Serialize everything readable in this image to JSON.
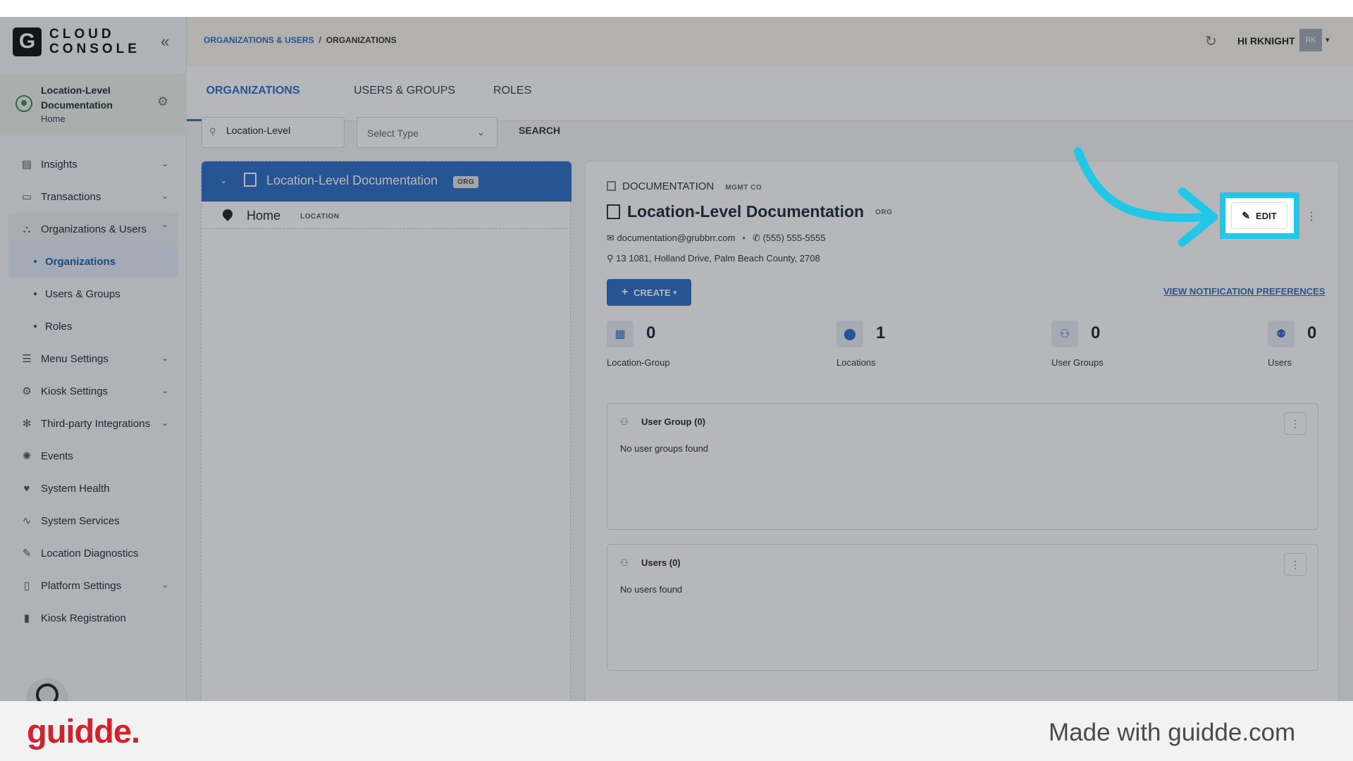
{
  "logo": {
    "mark": "G",
    "line1": "CLOUD",
    "line2": "CONSOLE"
  },
  "org": {
    "name": "Location-Level Documentation",
    "sub": "Home"
  },
  "nav": {
    "insights": "Insights",
    "transactions": "Transactions",
    "orgs_users": "Organizations & Users",
    "sub_organizations": "Organizations",
    "sub_users_groups": "Users & Groups",
    "sub_roles": "Roles",
    "menu_settings": "Menu Settings",
    "kiosk_settings": "Kiosk Settings",
    "third_party": "Third-party Integrations",
    "events": "Events",
    "system_health": "System Health",
    "system_services": "System Services",
    "location_diagnostics": "Location Diagnostics",
    "platform_settings": "Platform Settings",
    "kiosk_registration": "Kiosk Registration"
  },
  "header": {
    "crumb1": "ORGANIZATIONS & USERS",
    "crumb_sep": "/",
    "crumb2": "ORGANIZATIONS",
    "greeting": "HI RKNIGHT",
    "avatar": "RK"
  },
  "tabs": {
    "t1": "ORGANIZATIONS",
    "t2": "USERS & GROUPS",
    "t3": "ROLES"
  },
  "search": {
    "value": "Location-Level",
    "select_value": "Select Type",
    "button": "SEARCH"
  },
  "tree": {
    "root_label": "Location-Level Documentation",
    "root_tag": "ORG",
    "child_label": "Home",
    "child_tag": "LOCATION"
  },
  "detail": {
    "parent_label": "DOCUMENTATION",
    "parent_tag": "MGMT CO",
    "title": "Location-Level Documentation",
    "title_tag": "ORG",
    "email": "documentation@grubbrr.com",
    "phone": "(555) 555-5555",
    "address": "13 1081, Holland Drive, Palm Beach County, 2708",
    "create_label": "CREATE",
    "notif_link": "VIEW NOTIFICATION PREFERENCES",
    "edit_label": "EDIT"
  },
  "stats": {
    "location_group": {
      "value": "0",
      "label": "Location-Group"
    },
    "locations": {
      "value": "1",
      "label": "Locations"
    },
    "user_groups": {
      "value": "0",
      "label": "User Groups"
    },
    "users": {
      "value": "0",
      "label": "Users"
    }
  },
  "cards": {
    "groups_title": "User Group (0)",
    "groups_empty": "No user groups found",
    "users_title": "Users (0)",
    "users_empty": "No users found"
  },
  "footer": {
    "brand": "guidde.",
    "made_with": "Made with guidde.com"
  },
  "colors": {
    "accent": "#2e6fc6",
    "highlight": "#22c7e8",
    "brand": "#d3212d"
  }
}
